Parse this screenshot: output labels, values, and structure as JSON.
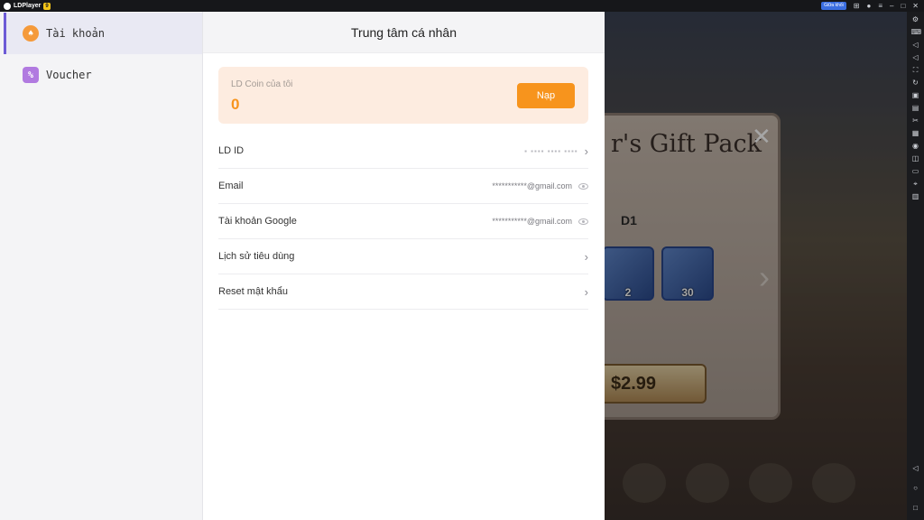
{
  "titlebar": {
    "app_name": "LDPlayer",
    "version_badge": "9",
    "badge_label": "Giữa khối"
  },
  "panel": {
    "title": "Trung tâm cá nhân",
    "nav": [
      {
        "label": "Tài khoản",
        "icon": "account-icon"
      },
      {
        "label": "Voucher",
        "icon": "voucher-icon"
      }
    ],
    "coin": {
      "label": "LD Coin của tôi",
      "value": "0",
      "button": "Nạp"
    },
    "rows": [
      {
        "label": "LD ID",
        "value": "▪ ▪▪▪▪ ▪▪▪▪ ▪▪▪▪",
        "action": "chevron"
      },
      {
        "label": "Email",
        "value": "***********@gmail.com",
        "action": "eye"
      },
      {
        "label": "Tài khoản Google",
        "value": "***********@gmail.com",
        "action": "eye"
      },
      {
        "label": "Lịch sử tiêu dùng",
        "value": "",
        "action": "chevron"
      },
      {
        "label": "Reset mật khẩu",
        "value": "",
        "action": "chevron"
      }
    ]
  },
  "game": {
    "gift_title": "r's Gift Pack",
    "day_label": "D1",
    "items": [
      {
        "qty": "2"
      },
      {
        "qty": "30"
      }
    ],
    "price": "$2.99"
  },
  "colors": {
    "accent": "#f7941d",
    "active_nav": "#6d5bd6"
  }
}
